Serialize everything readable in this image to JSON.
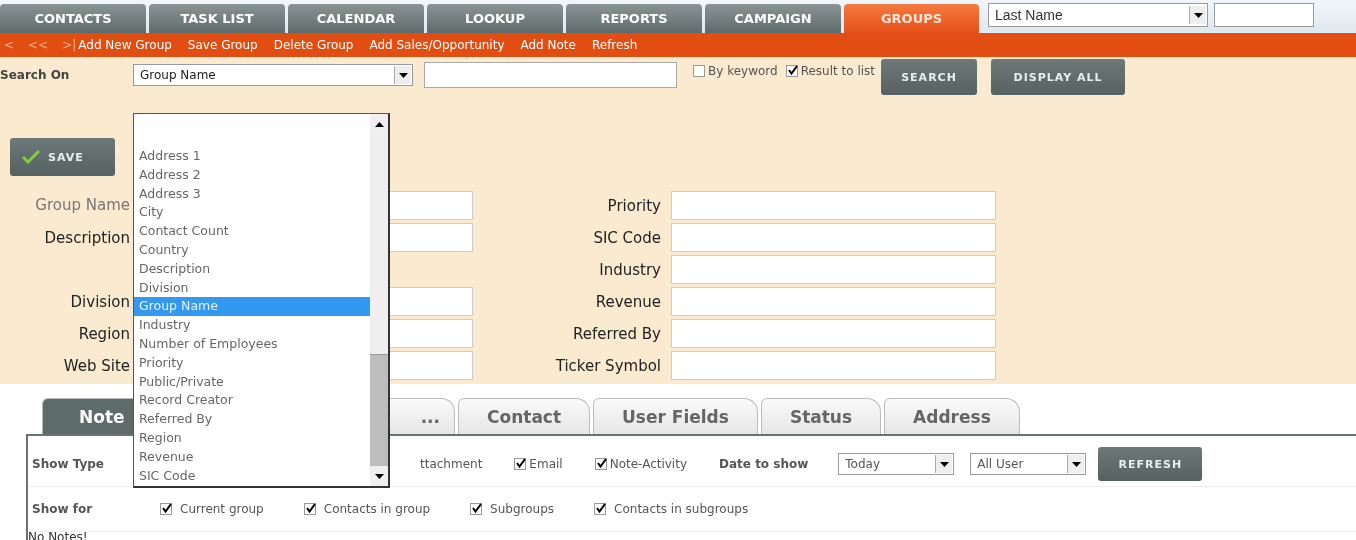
{
  "nav_tabs": [
    {
      "label": "CONTACTS",
      "selected": false
    },
    {
      "label": "TASK LIST",
      "selected": false
    },
    {
      "label": "CALENDAR",
      "selected": false
    },
    {
      "label": "LOOKUP",
      "selected": false
    },
    {
      "label": "REPORTS",
      "selected": false
    },
    {
      "label": "CAMPAIGN",
      "selected": false
    },
    {
      "label": "GROUPS",
      "selected": true
    }
  ],
  "top_search": {
    "field": "Last Name"
  },
  "action_bar": {
    "pager": [
      "<",
      "<<",
      ">|"
    ],
    "links": [
      "Add New Group",
      "Save Group",
      "Delete Group",
      "Add Sales/Opportunity",
      "Add Note",
      "Refresh"
    ]
  },
  "search": {
    "label": "Search On",
    "field": "Group Name",
    "by_keyword": {
      "label": "By keyword",
      "checked": false
    },
    "result_to_list": {
      "label": "Result to list",
      "checked": true
    },
    "buttons": [
      "SEARCH",
      "DISPLAY ALL"
    ]
  },
  "field_dropdown": {
    "options": [
      {
        "label": "Address 1",
        "selected": false
      },
      {
        "label": "Address 2",
        "selected": false
      },
      {
        "label": "Address 3",
        "selected": false
      },
      {
        "label": "City",
        "selected": false
      },
      {
        "label": "Contact Count",
        "selected": false
      },
      {
        "label": "Country",
        "selected": false
      },
      {
        "label": "Description",
        "selected": false
      },
      {
        "label": "Division",
        "selected": false
      },
      {
        "label": "Group Name",
        "selected": true
      },
      {
        "label": "Industry",
        "selected": false
      },
      {
        "label": "Number of Employees",
        "selected": false
      },
      {
        "label": "Priority",
        "selected": false
      },
      {
        "label": "Public/Private",
        "selected": false
      },
      {
        "label": "Record Creator",
        "selected": false
      },
      {
        "label": "Referred By",
        "selected": false
      },
      {
        "label": "Region",
        "selected": false
      },
      {
        "label": "Revenue",
        "selected": false
      },
      {
        "label": "SIC Code",
        "selected": false
      }
    ]
  },
  "save_button": "SAVE",
  "form": {
    "rows": [
      {
        "left": "Group Name",
        "right": "Priority"
      },
      {
        "left": "Description",
        "right": "SIC Code"
      },
      {
        "right": "Industry"
      },
      {
        "left": "Division",
        "right": "Revenue"
      },
      {
        "left": "Region",
        "right": "Referred By"
      },
      {
        "left": "Web Site",
        "right": "Ticker Symbol"
      }
    ]
  },
  "detail_tabs": [
    {
      "label": "Note",
      "selected": true
    },
    {
      "label": "...",
      "selected": false
    },
    {
      "label": "Contact",
      "selected": false
    },
    {
      "label": "User Fields",
      "selected": false
    },
    {
      "label": "Status",
      "selected": false
    },
    {
      "label": "Address",
      "selected": false
    }
  ],
  "notes": {
    "show_type": {
      "label": "Show Type",
      "options": [
        {
          "kind": "partial",
          "label": "ttachment"
        },
        {
          "kind": "checkbox",
          "label": "Email",
          "checked": true
        },
        {
          "kind": "checkbox",
          "label": "Note-Activity",
          "checked": true
        }
      ]
    },
    "date_label": "Date to show",
    "date": "Today",
    "user": "All User",
    "refresh": "REFRESH",
    "show_for": {
      "label": "Show for",
      "options": [
        {
          "label": "Current group",
          "checked": true
        },
        {
          "label": "Contacts in group",
          "checked": true
        },
        {
          "label": "Subgroups",
          "checked": true
        },
        {
          "label": "Contacts in subgroups",
          "checked": true
        }
      ]
    },
    "empty": "No Notes!"
  }
}
